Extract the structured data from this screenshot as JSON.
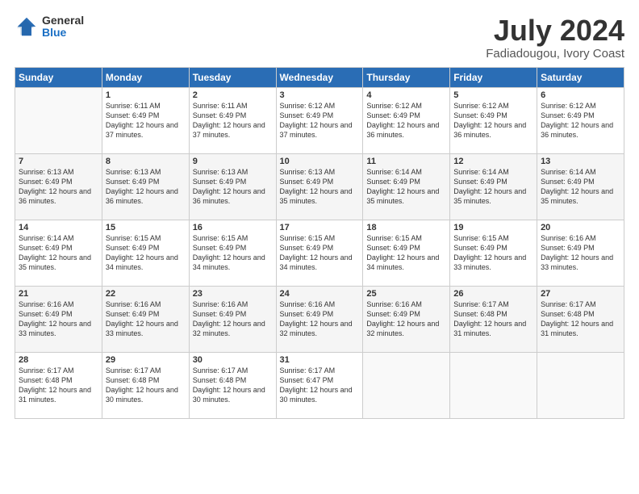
{
  "logo": {
    "general": "General",
    "blue": "Blue"
  },
  "header": {
    "month": "July 2024",
    "location": "Fadiadougou, Ivory Coast"
  },
  "weekdays": [
    "Sunday",
    "Monday",
    "Tuesday",
    "Wednesday",
    "Thursday",
    "Friday",
    "Saturday"
  ],
  "weeks": [
    [
      {
        "day": "",
        "sunrise": "",
        "sunset": "",
        "daylight": ""
      },
      {
        "day": "1",
        "sunrise": "Sunrise: 6:11 AM",
        "sunset": "Sunset: 6:49 PM",
        "daylight": "Daylight: 12 hours and 37 minutes."
      },
      {
        "day": "2",
        "sunrise": "Sunrise: 6:11 AM",
        "sunset": "Sunset: 6:49 PM",
        "daylight": "Daylight: 12 hours and 37 minutes."
      },
      {
        "day": "3",
        "sunrise": "Sunrise: 6:12 AM",
        "sunset": "Sunset: 6:49 PM",
        "daylight": "Daylight: 12 hours and 37 minutes."
      },
      {
        "day": "4",
        "sunrise": "Sunrise: 6:12 AM",
        "sunset": "Sunset: 6:49 PM",
        "daylight": "Daylight: 12 hours and 36 minutes."
      },
      {
        "day": "5",
        "sunrise": "Sunrise: 6:12 AM",
        "sunset": "Sunset: 6:49 PM",
        "daylight": "Daylight: 12 hours and 36 minutes."
      },
      {
        "day": "6",
        "sunrise": "Sunrise: 6:12 AM",
        "sunset": "Sunset: 6:49 PM",
        "daylight": "Daylight: 12 hours and 36 minutes."
      }
    ],
    [
      {
        "day": "7",
        "sunrise": "Sunrise: 6:13 AM",
        "sunset": "Sunset: 6:49 PM",
        "daylight": "Daylight: 12 hours and 36 minutes."
      },
      {
        "day": "8",
        "sunrise": "Sunrise: 6:13 AM",
        "sunset": "Sunset: 6:49 PM",
        "daylight": "Daylight: 12 hours and 36 minutes."
      },
      {
        "day": "9",
        "sunrise": "Sunrise: 6:13 AM",
        "sunset": "Sunset: 6:49 PM",
        "daylight": "Daylight: 12 hours and 36 minutes."
      },
      {
        "day": "10",
        "sunrise": "Sunrise: 6:13 AM",
        "sunset": "Sunset: 6:49 PM",
        "daylight": "Daylight: 12 hours and 35 minutes."
      },
      {
        "day": "11",
        "sunrise": "Sunrise: 6:14 AM",
        "sunset": "Sunset: 6:49 PM",
        "daylight": "Daylight: 12 hours and 35 minutes."
      },
      {
        "day": "12",
        "sunrise": "Sunrise: 6:14 AM",
        "sunset": "Sunset: 6:49 PM",
        "daylight": "Daylight: 12 hours and 35 minutes."
      },
      {
        "day": "13",
        "sunrise": "Sunrise: 6:14 AM",
        "sunset": "Sunset: 6:49 PM",
        "daylight": "Daylight: 12 hours and 35 minutes."
      }
    ],
    [
      {
        "day": "14",
        "sunrise": "Sunrise: 6:14 AM",
        "sunset": "Sunset: 6:49 PM",
        "daylight": "Daylight: 12 hours and 35 minutes."
      },
      {
        "day": "15",
        "sunrise": "Sunrise: 6:15 AM",
        "sunset": "Sunset: 6:49 PM",
        "daylight": "Daylight: 12 hours and 34 minutes."
      },
      {
        "day": "16",
        "sunrise": "Sunrise: 6:15 AM",
        "sunset": "Sunset: 6:49 PM",
        "daylight": "Daylight: 12 hours and 34 minutes."
      },
      {
        "day": "17",
        "sunrise": "Sunrise: 6:15 AM",
        "sunset": "Sunset: 6:49 PM",
        "daylight": "Daylight: 12 hours and 34 minutes."
      },
      {
        "day": "18",
        "sunrise": "Sunrise: 6:15 AM",
        "sunset": "Sunset: 6:49 PM",
        "daylight": "Daylight: 12 hours and 34 minutes."
      },
      {
        "day": "19",
        "sunrise": "Sunrise: 6:15 AM",
        "sunset": "Sunset: 6:49 PM",
        "daylight": "Daylight: 12 hours and 33 minutes."
      },
      {
        "day": "20",
        "sunrise": "Sunrise: 6:16 AM",
        "sunset": "Sunset: 6:49 PM",
        "daylight": "Daylight: 12 hours and 33 minutes."
      }
    ],
    [
      {
        "day": "21",
        "sunrise": "Sunrise: 6:16 AM",
        "sunset": "Sunset: 6:49 PM",
        "daylight": "Daylight: 12 hours and 33 minutes."
      },
      {
        "day": "22",
        "sunrise": "Sunrise: 6:16 AM",
        "sunset": "Sunset: 6:49 PM",
        "daylight": "Daylight: 12 hours and 33 minutes."
      },
      {
        "day": "23",
        "sunrise": "Sunrise: 6:16 AM",
        "sunset": "Sunset: 6:49 PM",
        "daylight": "Daylight: 12 hours and 32 minutes."
      },
      {
        "day": "24",
        "sunrise": "Sunrise: 6:16 AM",
        "sunset": "Sunset: 6:49 PM",
        "daylight": "Daylight: 12 hours and 32 minutes."
      },
      {
        "day": "25",
        "sunrise": "Sunrise: 6:16 AM",
        "sunset": "Sunset: 6:49 PM",
        "daylight": "Daylight: 12 hours and 32 minutes."
      },
      {
        "day": "26",
        "sunrise": "Sunrise: 6:17 AM",
        "sunset": "Sunset: 6:48 PM",
        "daylight": "Daylight: 12 hours and 31 minutes."
      },
      {
        "day": "27",
        "sunrise": "Sunrise: 6:17 AM",
        "sunset": "Sunset: 6:48 PM",
        "daylight": "Daylight: 12 hours and 31 minutes."
      }
    ],
    [
      {
        "day": "28",
        "sunrise": "Sunrise: 6:17 AM",
        "sunset": "Sunset: 6:48 PM",
        "daylight": "Daylight: 12 hours and 31 minutes."
      },
      {
        "day": "29",
        "sunrise": "Sunrise: 6:17 AM",
        "sunset": "Sunset: 6:48 PM",
        "daylight": "Daylight: 12 hours and 30 minutes."
      },
      {
        "day": "30",
        "sunrise": "Sunrise: 6:17 AM",
        "sunset": "Sunset: 6:48 PM",
        "daylight": "Daylight: 12 hours and 30 minutes."
      },
      {
        "day": "31",
        "sunrise": "Sunrise: 6:17 AM",
        "sunset": "Sunset: 6:47 PM",
        "daylight": "Daylight: 12 hours and 30 minutes."
      },
      {
        "day": "",
        "sunrise": "",
        "sunset": "",
        "daylight": ""
      },
      {
        "day": "",
        "sunrise": "",
        "sunset": "",
        "daylight": ""
      },
      {
        "day": "",
        "sunrise": "",
        "sunset": "",
        "daylight": ""
      }
    ]
  ]
}
